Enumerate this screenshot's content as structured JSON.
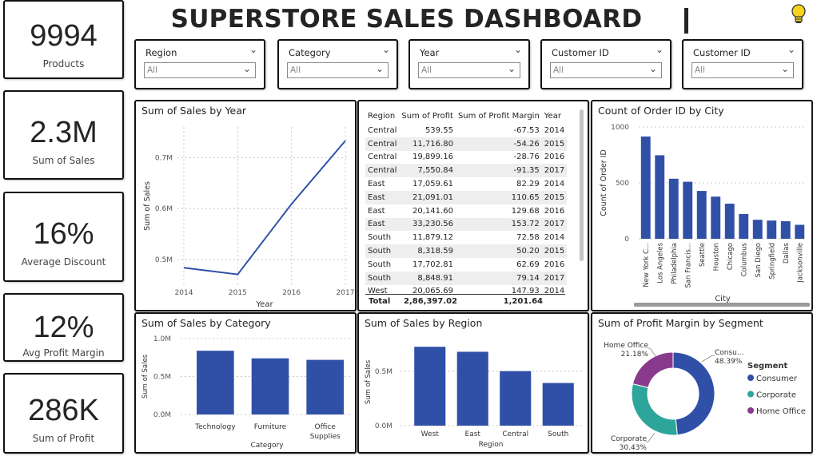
{
  "header": {
    "title": "SUPERSTORE SALES DASHBOARD",
    "bulb_icon": "lightbulb-icon"
  },
  "kpis": [
    {
      "value": "9994",
      "label": "Products"
    },
    {
      "value": "2.3M",
      "label": "Sum of Sales"
    },
    {
      "value": "16%",
      "label": "Average Discount"
    },
    {
      "value": "12%",
      "label": "Avg Profit Margin"
    },
    {
      "value": "286K",
      "label": "Sum of Profit"
    }
  ],
  "slicers": [
    {
      "label": "Region",
      "value": "All"
    },
    {
      "label": "Category",
      "value": "All"
    },
    {
      "label": "Year",
      "value": "All"
    },
    {
      "label": "Customer ID",
      "value": "All"
    },
    {
      "label": "Customer ID",
      "value": "All"
    }
  ],
  "table": {
    "headers": [
      "Region",
      "Sum of Profit",
      "Sum of Profit Margin",
      "Year"
    ],
    "rows": [
      [
        "Central",
        "539.55",
        "-67.53",
        "2014"
      ],
      [
        "Central",
        "11,716.80",
        "-54.26",
        "2015"
      ],
      [
        "Central",
        "19,899.16",
        "-28.76",
        "2016"
      ],
      [
        "Central",
        "7,550.84",
        "-91.35",
        "2017"
      ],
      [
        "East",
        "17,059.61",
        "82.29",
        "2014"
      ],
      [
        "East",
        "21,091.01",
        "110.65",
        "2015"
      ],
      [
        "East",
        "20,141.60",
        "129.68",
        "2016"
      ],
      [
        "East",
        "33,230.56",
        "153.72",
        "2017"
      ],
      [
        "South",
        "11,879.12",
        "72.58",
        "2014"
      ],
      [
        "South",
        "8,318.59",
        "50.20",
        "2015"
      ],
      [
        "South",
        "17,702.81",
        "62.69",
        "2016"
      ],
      [
        "South",
        "8,848.91",
        "79.14",
        "2017"
      ],
      [
        "West",
        "20,065.69",
        "147.93",
        "2014"
      ]
    ],
    "total": [
      "Total",
      "2,86,397.02",
      "1,201.64",
      ""
    ]
  },
  "colors": {
    "bar": "#3050a8",
    "line": "#3050a8",
    "consumer": "#3050a8",
    "corporate": "#2ea59a",
    "home_office": "#8a3a8c",
    "grid": "#c8c8c8"
  },
  "chart_data": [
    {
      "type": "line",
      "title": "Sum of Sales by Year",
      "xlabel": "Year",
      "ylabel": "Sum of Sales",
      "x": [
        "2014",
        "2015",
        "2016",
        "2017"
      ],
      "series": [
        {
          "values": [
            0.484,
            0.471,
            0.609,
            0.733
          ]
        }
      ],
      "ylim": [
        0.45,
        0.76
      ],
      "yticks": [
        0.5,
        0.6,
        0.7
      ],
      "ytick_labels": [
        "0.5M",
        "0.6M",
        "0.7M"
      ],
      "grid": true
    },
    {
      "type": "bar",
      "title": "Count of Order ID by City",
      "xlabel": "City",
      "ylabel": "Count of Order ID",
      "categories": [
        "New York C...",
        "Los Angeles",
        "Philadelphia",
        "San Francis...",
        "Seattle",
        "Houston",
        "Chicago",
        "Columbus",
        "San Diego",
        "Springfield",
        "Dallas",
        "Jacksonville"
      ],
      "values": [
        915,
        747,
        537,
        510,
        428,
        377,
        314,
        222,
        170,
        163,
        157,
        125
      ],
      "ylim": [
        0,
        1000
      ],
      "yticks": [
        0,
        500,
        1000
      ],
      "ytick_labels": [
        "0",
        "500",
        "1000"
      ],
      "grid": true
    },
    {
      "type": "bar",
      "title": "Sum of Sales by Category",
      "xlabel": "Category",
      "ylabel": "Sum of Sales",
      "categories": [
        "Technology",
        "Furniture",
        "Office Supplies"
      ],
      "values": [
        0.84,
        0.74,
        0.72
      ],
      "ylim": [
        0,
        1.0
      ],
      "yticks": [
        0,
        0.5,
        1.0
      ],
      "ytick_labels": [
        "0.0M",
        "0.5M",
        "1.0M"
      ],
      "grid": true
    },
    {
      "type": "bar",
      "title": "Sum of Sales by Region",
      "xlabel": "Region",
      "ylabel": "Sum of Sales",
      "categories": [
        "West",
        "East",
        "Central",
        "South"
      ],
      "values": [
        0.725,
        0.679,
        0.501,
        0.392
      ],
      "ylim": [
        0,
        0.8
      ],
      "yticks": [
        0,
        0.5
      ],
      "ytick_labels": [
        "0.0M",
        "0.5M"
      ],
      "grid": true
    },
    {
      "type": "pie",
      "title": "Sum of Profit Margin by Segment",
      "legend_title": "Segment",
      "legend_position": "right",
      "slices": [
        {
          "name": "Consumer",
          "short_label": "Consu...",
          "pct_label": "48.39%",
          "value": 48.39
        },
        {
          "name": "Corporate",
          "short_label": "Corporate",
          "pct_label": "30.43%",
          "value": 30.43
        },
        {
          "name": "Home Office",
          "short_label": "Home Office",
          "pct_label": "21.18%",
          "value": 21.18
        }
      ]
    }
  ]
}
